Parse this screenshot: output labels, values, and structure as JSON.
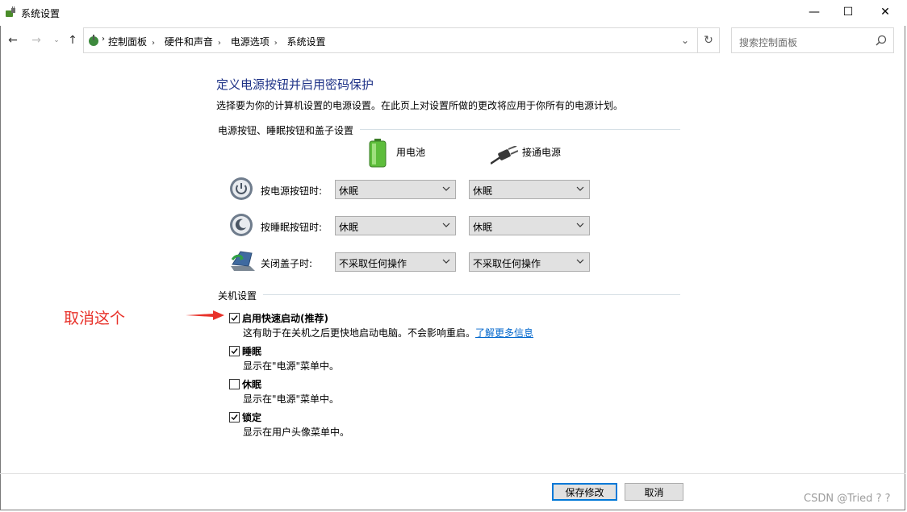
{
  "window": {
    "title": "系统设置",
    "controls": {
      "minimize": "—",
      "maximize": "☐",
      "close": "✕"
    }
  },
  "address_bar": {
    "breadcrumbs": [
      "控制面板",
      "硬件和声音",
      "电源选项",
      "系统设置"
    ],
    "search_placeholder": "搜索控制面板"
  },
  "page": {
    "title": "定义电源按钮并启用密码保护",
    "description": "选择要为你的计算机设置的电源设置。在此页上对设置所做的更改将应用于你所有的电源计划。"
  },
  "power_buttons": {
    "group_label": "电源按钮、睡眠按钮和盖子设置",
    "columns": {
      "battery": "用电池",
      "plugged_in": "接通电源"
    },
    "rows": [
      {
        "label": "按电源按钮时:",
        "battery": "休眠",
        "plugged_in": "休眠",
        "icon": "power-button-icon"
      },
      {
        "label": "按睡眠按钮时:",
        "battery": "休眠",
        "plugged_in": "休眠",
        "icon": "sleep-button-icon"
      },
      {
        "label": "关闭盖子时:",
        "battery": "不采取任何操作",
        "plugged_in": "不采取任何操作",
        "icon": "laptop-lid-icon"
      }
    ]
  },
  "shutdown": {
    "group_label": "关机设置",
    "options": [
      {
        "label": "启用快速启动(推荐)",
        "desc": "这有助于在关机之后更快地启动电脑。不会影响重启。",
        "link": "了解更多信息",
        "checked": true
      },
      {
        "label": "睡眠",
        "desc": "显示在\"电源\"菜单中。",
        "checked": true
      },
      {
        "label": "休眠",
        "desc": "显示在\"电源\"菜单中。",
        "checked": false
      },
      {
        "label": "锁定",
        "desc": "显示在用户头像菜单中。",
        "checked": true
      }
    ]
  },
  "annotation": {
    "text": "取消这个",
    "color": "#e8322a"
  },
  "buttons": {
    "save": "保存修改",
    "cancel": "取消"
  },
  "watermark": "CSDN @Tried ? ?",
  "colors": {
    "title_blue": "#1e3287",
    "link_blue": "#0066cc",
    "accent": "#0078d7"
  }
}
